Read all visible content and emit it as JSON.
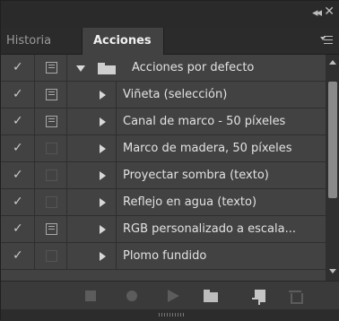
{
  "window": {
    "collapse_glyph": "◂◂",
    "close_glyph": "✕"
  },
  "tabs": [
    {
      "label": "Historia",
      "active": false
    },
    {
      "label": "Acciones",
      "active": true
    }
  ],
  "list": {
    "set": {
      "label": "Acciones por defecto",
      "checked": true,
      "dialog": true,
      "expanded": true
    },
    "actions": [
      {
        "label": "Viñeta (selección)",
        "checked": true,
        "dialog": true
      },
      {
        "label": "Canal de marco - 50 píxeles",
        "checked": true,
        "dialog": true
      },
      {
        "label": "Marco de madera, 50 píxeles",
        "checked": true,
        "dialog": false
      },
      {
        "label": "Proyectar sombra (texto)",
        "checked": true,
        "dialog": false
      },
      {
        "label": "Reflejo en agua (texto)",
        "checked": true,
        "dialog": false
      },
      {
        "label": "RGB personalizado a escala...",
        "checked": true,
        "dialog": true
      },
      {
        "label": "Plomo fundido",
        "checked": true,
        "dialog": false
      }
    ]
  },
  "icons": {
    "check": "✓",
    "stop": "stop-icon",
    "record": "record-icon",
    "play": "play-icon",
    "new_set": "folder-icon",
    "new_action": "new-action-icon",
    "delete": "trash-icon"
  },
  "colors": {
    "panel_bg": "#323232",
    "list_bg": "#424242",
    "active_tab_bg": "#424242",
    "text": "#e2e2e2"
  }
}
